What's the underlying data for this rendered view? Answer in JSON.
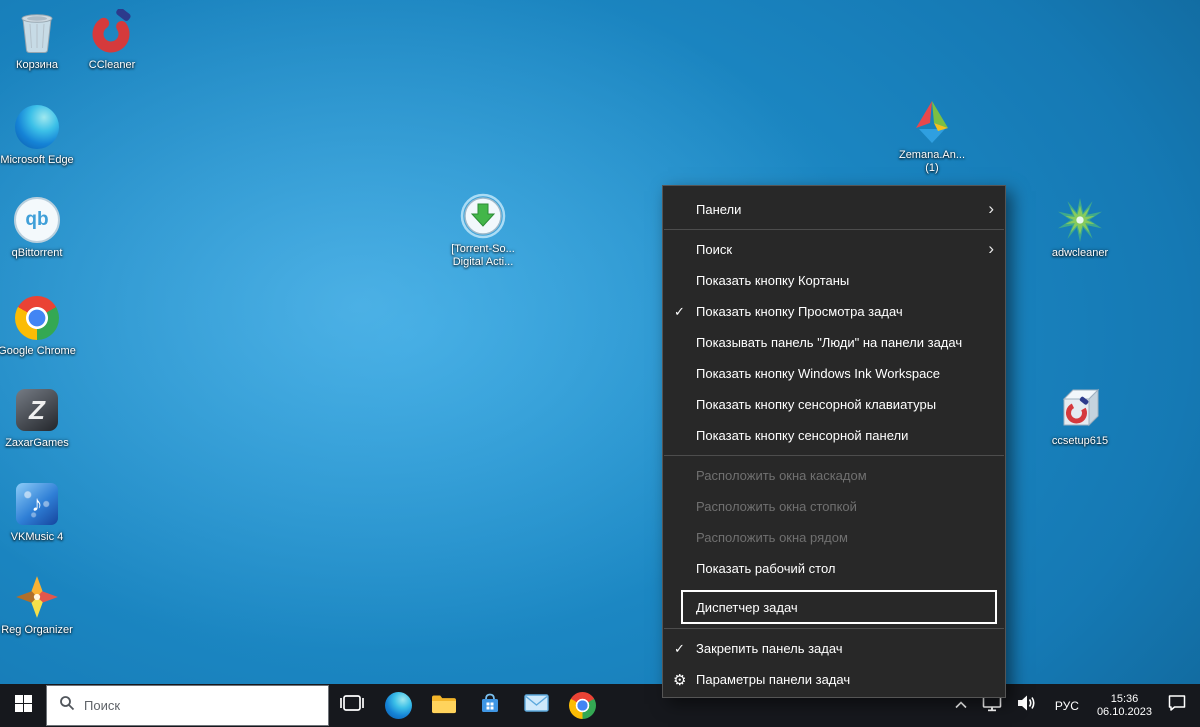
{
  "colors": {
    "desktop_accent": "#259bd8",
    "menu_background": "#282828",
    "taskbar_background": "#16181d",
    "selection_outline": "#ffffff"
  },
  "icons": {
    "check": "✓",
    "gear": "⚙",
    "submenu_arrow": "›",
    "music_note": "♪"
  },
  "desktop": {
    "icons": [
      {
        "label": "Корзина"
      },
      {
        "label": "CCleaner"
      },
      {
        "label": "Microsoft Edge"
      },
      {
        "label": "qBittorrent",
        "icon_text": "qb"
      },
      {
        "label": "Google Chrome"
      },
      {
        "label": "ZaxarGames",
        "icon_text": "Z"
      },
      {
        "label": "VKMusic 4"
      },
      {
        "label": "Reg Organizer"
      },
      {
        "label": "[Torrent-So... Digital Acti..."
      },
      {
        "label": "Zemana.An... (1)"
      },
      {
        "label": "adwcleaner"
      },
      {
        "label": "ccsetup615"
      }
    ]
  },
  "context_menu": {
    "items": [
      {
        "label": "Панели",
        "submenu": true
      },
      {
        "type": "separator"
      },
      {
        "label": "Поиск",
        "submenu": true
      },
      {
        "label": "Показать кнопку Кортаны"
      },
      {
        "label": "Показать кнопку Просмотра задач",
        "checked": true
      },
      {
        "label": "Показывать панель \"Люди\" на панели задач"
      },
      {
        "label": "Показать кнопку Windows Ink Workspace"
      },
      {
        "label": "Показать кнопку сенсорной клавиатуры"
      },
      {
        "label": "Показать кнопку сенсорной панели"
      },
      {
        "type": "separator"
      },
      {
        "label": "Расположить окна каскадом",
        "disabled": true
      },
      {
        "label": "Расположить окна стопкой",
        "disabled": true
      },
      {
        "label": "Расположить окна рядом",
        "disabled": true
      },
      {
        "label": "Показать рабочий стол"
      },
      {
        "label": "Диспетчер задач",
        "selected": true
      },
      {
        "type": "separator"
      },
      {
        "label": "Закрепить панель задач",
        "checked": true
      },
      {
        "label": "Параметры панели задач",
        "gear": true
      }
    ]
  },
  "taskbar": {
    "search_placeholder": "Поиск",
    "tray": {
      "language": "РУС",
      "time": "15:36",
      "date": "06.10.2023"
    }
  }
}
